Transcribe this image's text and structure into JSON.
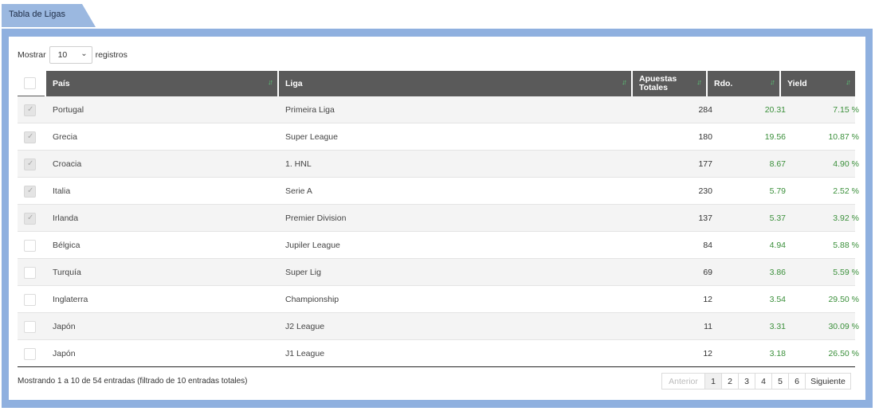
{
  "tab": {
    "label": "Tabla de Ligas"
  },
  "length_control": {
    "prefix": "Mostrar",
    "value": "10",
    "suffix": "registros"
  },
  "columns": [
    "País",
    "Liga",
    "Apuestas Totales",
    "Rdo.",
    "Yield"
  ],
  "columns_display": {
    "ap_line1": "Apuestas",
    "ap_line2": "Totales"
  },
  "rows": [
    {
      "checked": true,
      "pais": "Portugal",
      "liga": "Primeira Liga",
      "apuestas": "284",
      "rdo": "20.31",
      "yield": "7.15 %"
    },
    {
      "checked": true,
      "pais": "Grecia",
      "liga": "Super League",
      "apuestas": "180",
      "rdo": "19.56",
      "yield": "10.87 %"
    },
    {
      "checked": true,
      "pais": "Croacia",
      "liga": "1. HNL",
      "apuestas": "177",
      "rdo": "8.67",
      "yield": "4.90 %"
    },
    {
      "checked": true,
      "pais": "Italia",
      "liga": "Serie A",
      "apuestas": "230",
      "rdo": "5.79",
      "yield": "2.52 %"
    },
    {
      "checked": true,
      "pais": "Irlanda",
      "liga": "Premier Division",
      "apuestas": "137",
      "rdo": "5.37",
      "yield": "3.92 %"
    },
    {
      "checked": false,
      "pais": "Bélgica",
      "liga": "Jupiler League",
      "apuestas": "84",
      "rdo": "4.94",
      "yield": "5.88 %"
    },
    {
      "checked": false,
      "pais": "Turquía",
      "liga": "Super Lig",
      "apuestas": "69",
      "rdo": "3.86",
      "yield": "5.59 %"
    },
    {
      "checked": false,
      "pais": "Inglaterra",
      "liga": "Championship",
      "apuestas": "12",
      "rdo": "3.54",
      "yield": "29.50 %"
    },
    {
      "checked": false,
      "pais": "Japón",
      "liga": "J2 League",
      "apuestas": "11",
      "rdo": "3.31",
      "yield": "30.09 %"
    },
    {
      "checked": false,
      "pais": "Japón",
      "liga": "J1 League",
      "apuestas": "12",
      "rdo": "3.18",
      "yield": "26.50 %"
    }
  ],
  "footer": {
    "info": "Mostrando 1 a 10 de 54 entradas (filtrado de 10 entradas totales)",
    "prev_label": "Anterior",
    "pages": [
      "1",
      "2",
      "3",
      "4",
      "5",
      "6"
    ],
    "active_page": "1",
    "next_label": "Siguiente"
  },
  "colors": {
    "tab": "#9bb8e0",
    "frame": "#8fb0df",
    "header": "#5a5a5a",
    "positive": "#3a8f3a",
    "sort_icon": "#5cd07a"
  }
}
